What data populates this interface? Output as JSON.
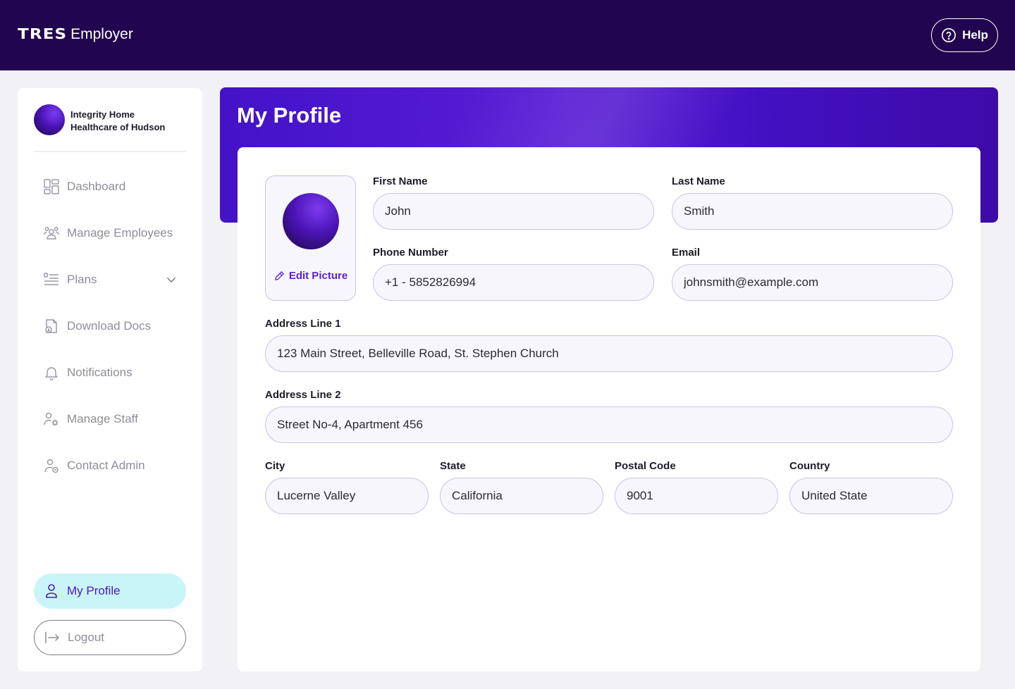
{
  "header": {
    "brand_logo": "TRES",
    "brand_name": "Employer",
    "help_label": "Help"
  },
  "sidebar": {
    "org_name": "Integrity Home Healthcare of Hudson",
    "items": [
      {
        "label": "Dashboard",
        "icon": "dashboard-icon"
      },
      {
        "label": "Manage Employees",
        "icon": "employees-icon"
      },
      {
        "label": "Plans",
        "icon": "plans-icon",
        "has_dropdown": true
      },
      {
        "label": "Download Docs",
        "icon": "download-doc-icon"
      },
      {
        "label": "Notifications",
        "icon": "bell-icon"
      },
      {
        "label": "Manage Staff",
        "icon": "staff-gear-icon"
      },
      {
        "label": "Contact Admin",
        "icon": "contact-admin-icon"
      }
    ],
    "profile_label": "My Profile",
    "logout_label": "Logout"
  },
  "main": {
    "title": "My Profile",
    "edit_picture_label": "Edit Picture",
    "fields": {
      "first_name": {
        "label": "First Name",
        "value": "John"
      },
      "last_name": {
        "label": "Last Name",
        "value": "Smith"
      },
      "phone": {
        "label": "Phone Number",
        "value": "+1 - 5852826994"
      },
      "email": {
        "label": "Email",
        "value": "johnsmith@example.com"
      },
      "address1": {
        "label": "Address Line 1",
        "value": "123 Main Street, Belleville Road, St. Stephen Church"
      },
      "address2": {
        "label": "Address Line 2",
        "value": "Street No-4, Apartment 456"
      },
      "city": {
        "label": "City",
        "value": "Lucerne Valley"
      },
      "state": {
        "label": "State",
        "value": "California"
      },
      "postal": {
        "label": "Postal Code",
        "value": "9001"
      },
      "country": {
        "label": "Country",
        "value": "United State"
      }
    }
  },
  "colors": {
    "header_bg": "#22054f",
    "accent": "#5a1fd6",
    "active_nav_bg": "#c9f5f9",
    "input_border": "#c6c3e8"
  }
}
